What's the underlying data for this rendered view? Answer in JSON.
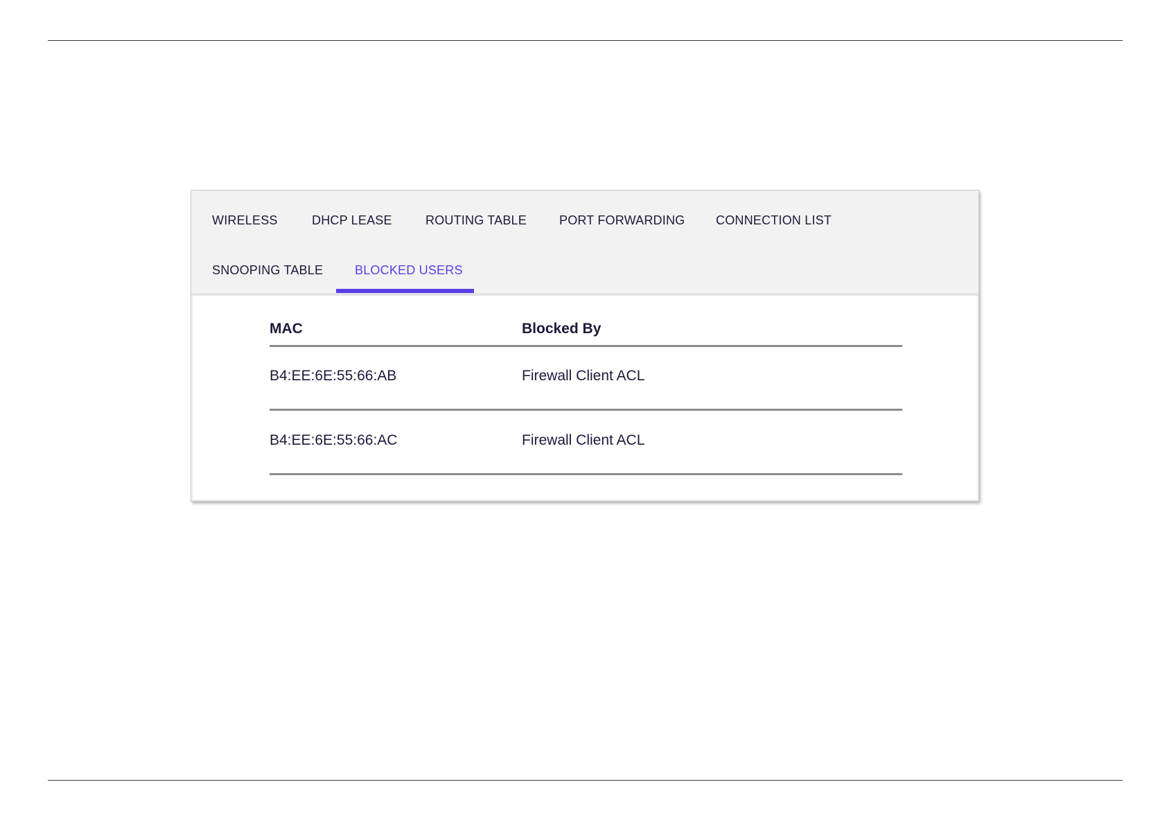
{
  "tabs": [
    {
      "label": "WIRELESS",
      "active": false
    },
    {
      "label": "DHCP LEASE",
      "active": false
    },
    {
      "label": "ROUTING TABLE",
      "active": false
    },
    {
      "label": "PORT FORWARDING",
      "active": false
    },
    {
      "label": "CONNECTION LIST",
      "active": false
    },
    {
      "label": "SNOOPING TABLE",
      "active": false
    },
    {
      "label": "BLOCKED USERS",
      "active": true
    }
  ],
  "table": {
    "headers": [
      "MAC",
      "Blocked By"
    ],
    "rows": [
      [
        "B4:EE:6E:55:66:AB",
        "Firewall Client ACL"
      ],
      [
        "B4:EE:6E:55:66:AC",
        "Firewall Client ACL"
      ]
    ]
  },
  "colors": {
    "accent": "#5b3fe6",
    "text": "#1c1a3a",
    "tab_bar_bg": "#f2f2f2",
    "row_divider": "#8c8c8c"
  }
}
